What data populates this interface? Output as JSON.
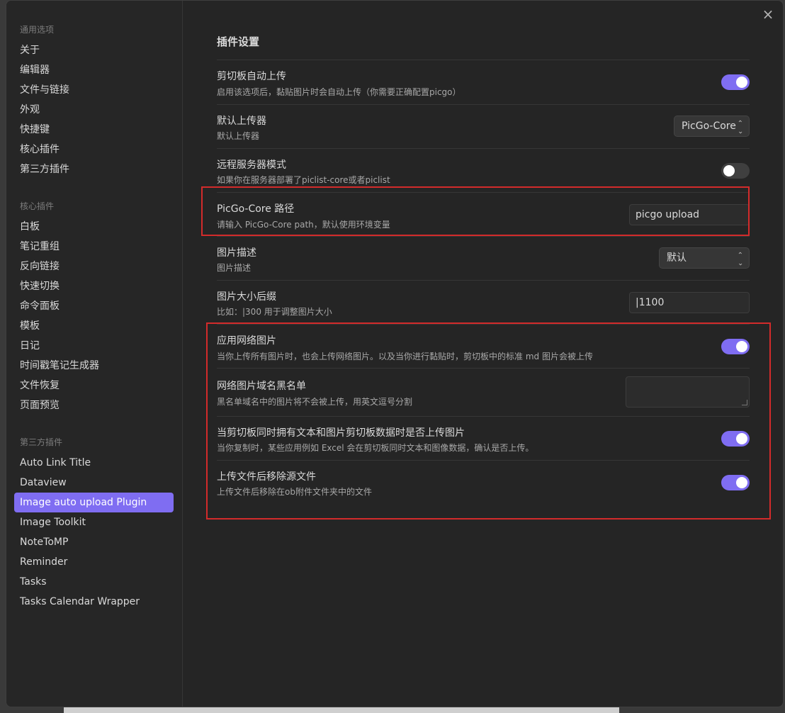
{
  "close_icon": "×",
  "sidebar": {
    "groups": [
      {
        "title": "通用选项",
        "items": [
          "关于",
          "编辑器",
          "文件与链接",
          "外观",
          "快捷键",
          "核心插件",
          "第三方插件"
        ]
      },
      {
        "title": "核心插件",
        "items": [
          "白板",
          "笔记重组",
          "反向链接",
          "快速切换",
          "命令面板",
          "模板",
          "日记",
          "时间戳笔记生成器",
          "文件恢复",
          "页面预览"
        ]
      },
      {
        "title": "第三方插件",
        "items": [
          "Auto Link Title",
          "Dataview",
          "Image auto upload Plugin",
          "Image Toolkit",
          "NoteToMP",
          "Reminder",
          "Tasks",
          "Tasks Calendar Wrapper"
        ]
      }
    ],
    "active_item": "Image auto upload Plugin",
    "accent_color": "#7f6df2"
  },
  "main": {
    "section_title": "插件设置",
    "settings": [
      {
        "name": "剪切板自动上传",
        "desc": "启用该选项后，黏贴图片时会自动上传（你需要正确配置picgo）",
        "control": "toggle",
        "on": true
      },
      {
        "name": "默认上传器",
        "desc": "默认上传器",
        "control": "select",
        "value": "PicGo-Core"
      },
      {
        "name": "远程服务器模式",
        "desc": "如果你在服务器部署了piclist-core或者piclist",
        "control": "toggle",
        "on": false
      },
      {
        "name": "PicGo-Core 路径",
        "desc": "请输入 PicGo-Core path，默认使用环境变量",
        "control": "text",
        "value": "picgo upload"
      },
      {
        "name": "图片描述",
        "desc": "图片描述",
        "control": "select",
        "value": "默认"
      },
      {
        "name": "图片大小后缀",
        "desc": "比如：|300 用于调整图片大小",
        "control": "text",
        "value": "|1100"
      },
      {
        "name": "应用网络图片",
        "desc": "当你上传所有图片时，也会上传网络图片。以及当你进行黏贴时，剪切板中的标准 md 图片会被上传",
        "control": "toggle",
        "on": true
      },
      {
        "name": "网络图片域名黑名单",
        "desc": "黑名单域名中的图片将不会被上传，用英文逗号分割",
        "control": "textarea",
        "value": ""
      },
      {
        "name": "当剪切板同时拥有文本和图片剪切板数据时是否上传图片",
        "desc": "当你复制时，某些应用例如 Excel 会在剪切板同时文本和图像数据，确认是否上传。",
        "control": "toggle",
        "on": true
      },
      {
        "name": "上传文件后移除源文件",
        "desc": "上传文件后移除在ob附件文件夹中的文件",
        "control": "toggle",
        "on": true
      }
    ],
    "highlight_color": "#d32b2b"
  }
}
